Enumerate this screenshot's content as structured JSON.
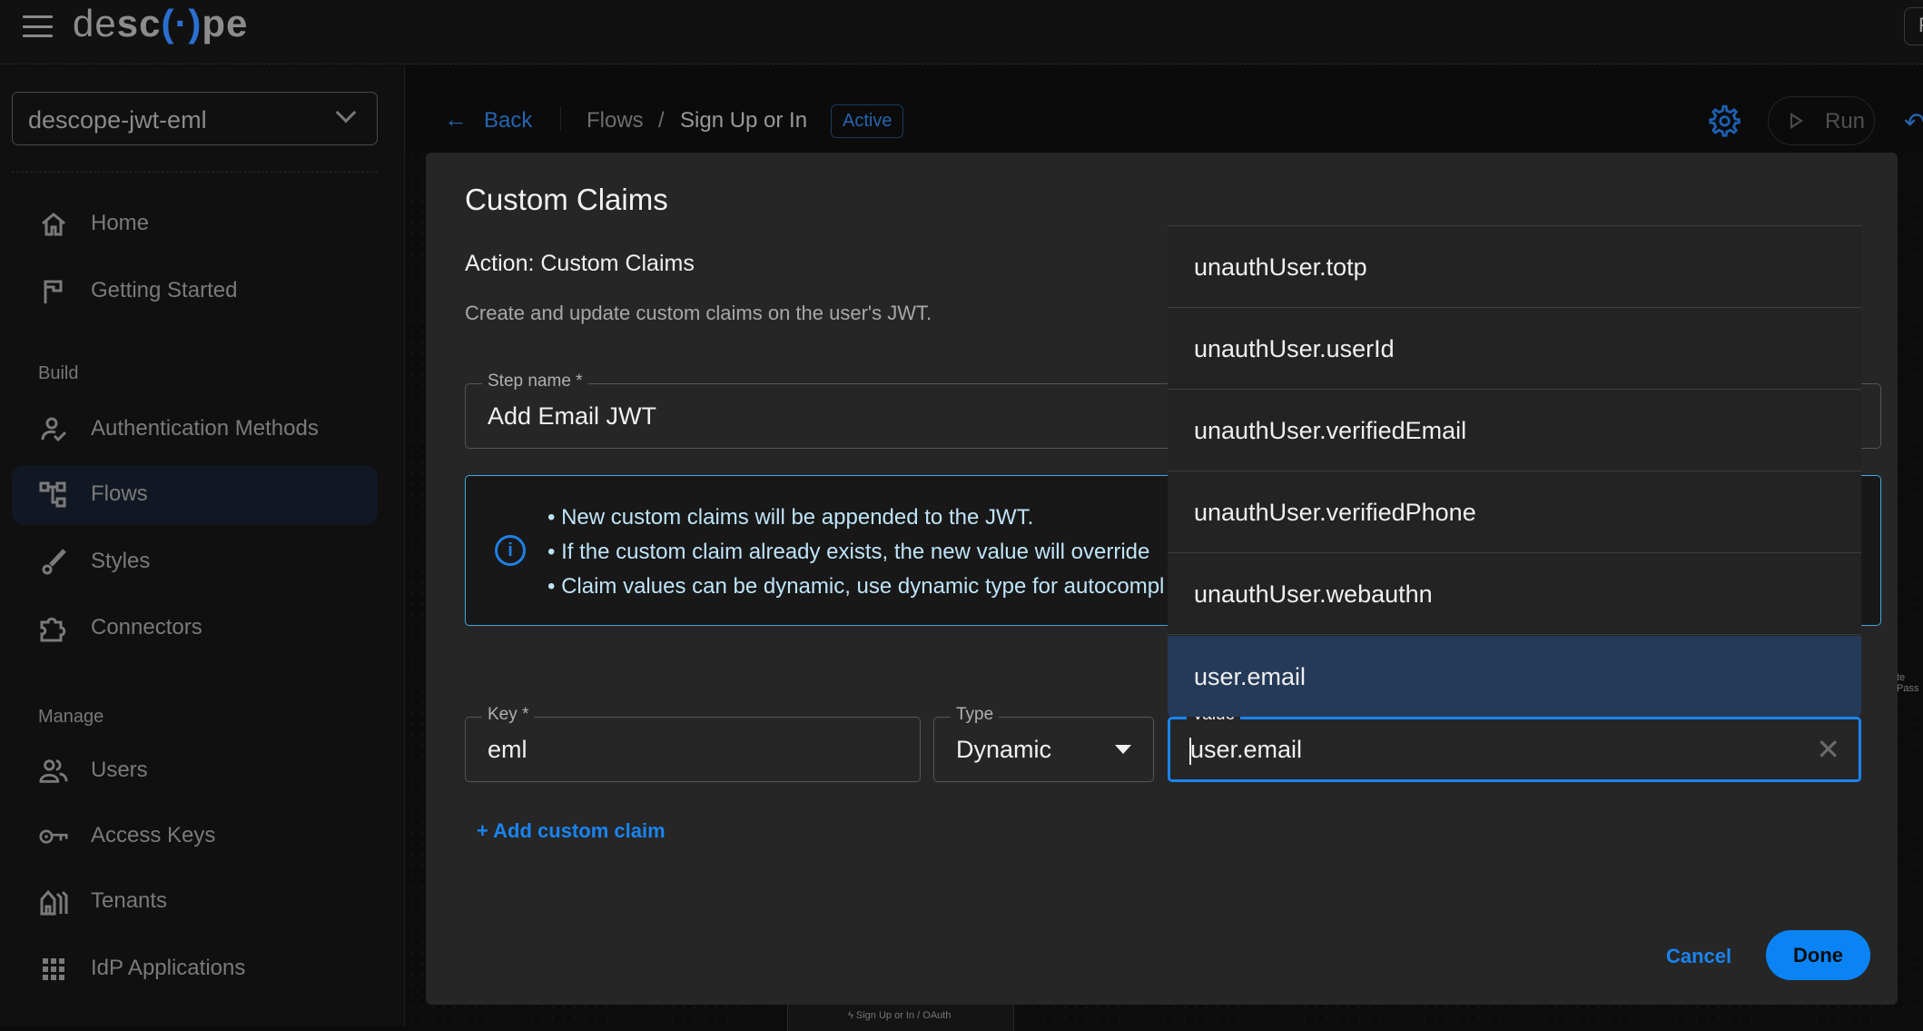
{
  "topbar": {
    "logo": {
      "part1": "de",
      "part2": "sc",
      "part3": "pe"
    },
    "right_button_partial": "F"
  },
  "sidebar": {
    "project": "descope-jwt-eml",
    "sections": {
      "build": "Build",
      "manage": "Manage"
    },
    "items": [
      {
        "label": "Home",
        "icon": "home-icon"
      },
      {
        "label": "Getting Started",
        "icon": "flag-icon"
      },
      {
        "label": "Authentication Methods",
        "icon": "user-check-icon"
      },
      {
        "label": "Flows",
        "icon": "flows-icon",
        "active": true
      },
      {
        "label": "Styles",
        "icon": "brush-icon"
      },
      {
        "label": "Connectors",
        "icon": "puzzle-icon"
      },
      {
        "label": "Users",
        "icon": "users-icon"
      },
      {
        "label": "Access Keys",
        "icon": "key-icon"
      },
      {
        "label": "Tenants",
        "icon": "tenants-icon"
      },
      {
        "label": "IdP Applications",
        "icon": "grid-icon"
      }
    ]
  },
  "header": {
    "back": "Back",
    "breadcrumb": {
      "parent": "Flows",
      "separator": "/",
      "current": "Sign Up or In"
    },
    "status_badge": "Active",
    "run": "Run"
  },
  "canvas": {
    "node_label": "Sign Up or In / OAuth",
    "node_partial": "te Pass"
  },
  "modal": {
    "title": "Custom Claims",
    "action_title": "Action: Custom Claims",
    "description": "Create and update custom claims on the user's JWT.",
    "step_name": {
      "label": "Step name *",
      "value": "Add Email JWT"
    },
    "info": [
      "• New custom claims will be appended to the JWT.",
      "• If the custom claim already exists, the new value will override",
      "• Claim values can be dynamic, use dynamic type for autocompl"
    ],
    "claim": {
      "key_label": "Key *",
      "key_value": "eml",
      "type_label": "Type",
      "type_value": "Dynamic",
      "value_label": "Value",
      "value_value": "user.email"
    },
    "autocomplete": [
      "unauthUser.totp",
      "unauthUser.userId",
      "unauthUser.verifiedEmail",
      "unauthUser.verifiedPhone",
      "unauthUser.webauthn",
      "user.email"
    ],
    "autocomplete_selected": "user.email",
    "add_claim": "+ Add custom claim",
    "cancel": "Cancel",
    "done": "Done"
  },
  "colors": {
    "accent": "#0a84f5",
    "selected_option": "#243a58",
    "info_border": "#3ea8df"
  }
}
